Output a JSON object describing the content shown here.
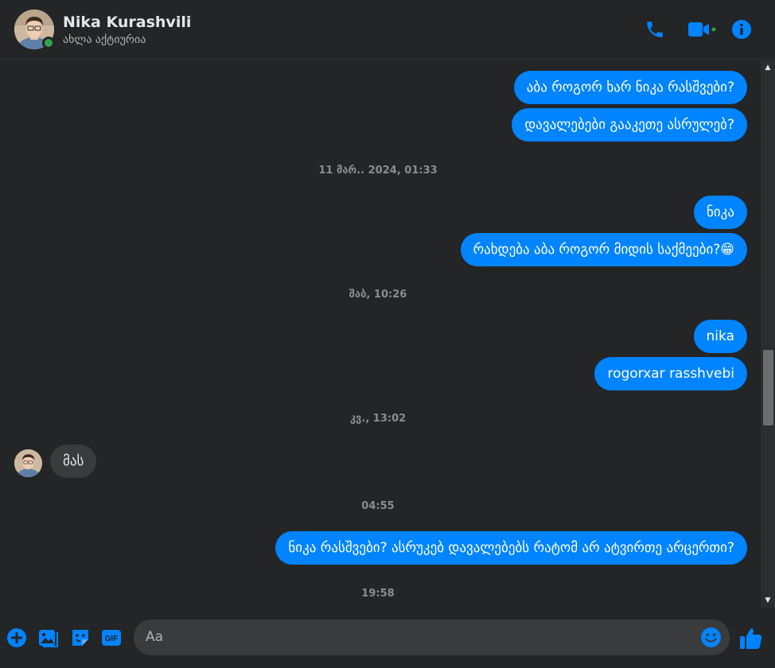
{
  "header": {
    "name": "Nika Kurashvili",
    "status": "ახლა აქტიურია"
  },
  "messages": {
    "m1": "აბა როგორ ხარ ნიკა რასშვები?",
    "m2": "დავალებები გააკეთე ასრულებ?",
    "t1": "11 მარ.. 2024, 01:33",
    "m3": "ნიკა",
    "m4": "რახდება აბა როგორ მიდის საქმეები?😁",
    "t2": "შაბ, 10:26",
    "m5": "nika",
    "m6": "rogorxar rasshvebi",
    "t3": "კვ., 13:02",
    "m7": "მას",
    "t4": "04:55",
    "m8": "ნიკა რასშვები?  ასრუკებ დავალებებს რატომ არ ატვირთე არცერთი?",
    "t5": "19:58"
  },
  "composer": {
    "placeholder": "Aa"
  },
  "colors": {
    "accent": "#0084ff",
    "background": "#242526",
    "online": "#31a24c"
  },
  "icons": [
    "phone-icon",
    "video-icon",
    "info-icon",
    "plus-icon",
    "gallery-icon",
    "sticker-icon",
    "gif-icon",
    "emoji-icon",
    "like-icon"
  ]
}
